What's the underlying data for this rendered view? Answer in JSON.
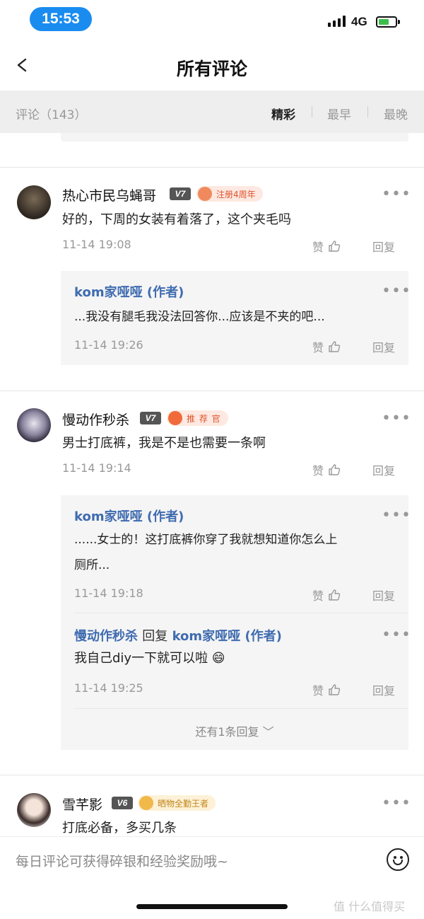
{
  "status_bar": {
    "time": "15:53",
    "network": "4G",
    "battery_color": "#3bbf4a"
  },
  "nav": {
    "title": "所有评论",
    "back_icon": "chevron-left-icon"
  },
  "filter": {
    "count_label": "评论（143）",
    "sort_options": [
      "精彩",
      "最早",
      "最晚"
    ],
    "active_sort": "精彩"
  },
  "colors": {
    "link": "#3f6cb0",
    "accent_time_pill": "#1a8cf0"
  },
  "comments": [
    {
      "user": "热心市民乌蝇哥",
      "level": "V7",
      "badge": "注册4周年",
      "text": "好的，下周的女装有着落了，这个夹毛吗",
      "time": "11-14 19:08",
      "like_label": "赞",
      "reply_label": "回复",
      "replies": [
        {
          "user": "kom家哑哑 (作者)",
          "text": "...我没有腿毛我没法回答你...应该是不夹的吧...",
          "time": "11-14 19:26"
        }
      ]
    },
    {
      "user": "慢动作秒杀",
      "level": "V7",
      "badge": "推 荐 官",
      "text": "男士打底裤，我是不是也需要一条啊",
      "time": "11-14 19:14",
      "like_label": "赞",
      "reply_label": "回复",
      "replies": [
        {
          "user": "kom家哑哑 (作者)",
          "text_line1": "......女士的！这打底裤你穿了我就想知道你怎么上",
          "text_line2": "厕所...",
          "time": "11-14 19:18"
        },
        {
          "user": "慢动作秒杀",
          "reply_word": "回复",
          "target": "kom家哑哑 (作者)",
          "text": "我自己diy一下就可以啦 😄",
          "time": "11-14 19:25"
        }
      ],
      "more_replies": "还有1条回复 ﹀"
    },
    {
      "user": "雪芊影",
      "level": "V6",
      "badge": "晒物全勤王者",
      "text": "打底必备，多买几条"
    }
  ],
  "input": {
    "placeholder": "每日评论可获得碎银和经验奖励哦~",
    "emoji_icon": "smiley-icon"
  },
  "watermark": "值 什么值得买"
}
